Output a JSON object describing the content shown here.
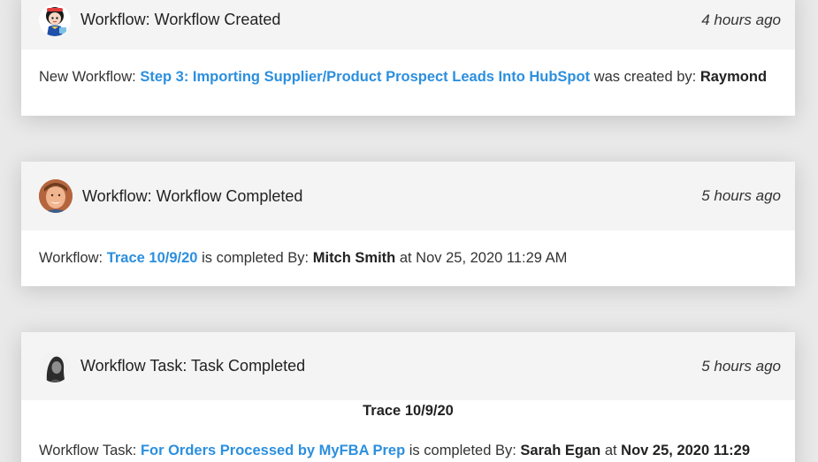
{
  "feed": {
    "items": [
      {
        "avatar_icon": "snow-white-avatar-icon",
        "title": "Workflow: Workflow Created",
        "time": "4 hours ago",
        "body": {
          "prefix": "New Workflow:",
          "link": "Step 3: Importing Supplier/Product Prospect Leads Into HubSpot",
          "middle": "was created by:",
          "user": "Raymond"
        }
      },
      {
        "avatar_icon": "user-photo-avatar-icon",
        "title": "Workflow: Workflow Completed",
        "time": "5 hours ago",
        "body": {
          "prefix": "Workflow:",
          "link": "Trace 10/9/20",
          "middle": "is completed By:",
          "user": "Mitch Smith",
          "suffix": "at Nov 25, 2020 11:29 AM"
        }
      },
      {
        "avatar_icon": "user-photo-avatar-icon",
        "title": "Workflow Task: Task Completed",
        "time": "5 hours ago",
        "body": {
          "heading": "Trace 10/9/20",
          "prefix": "Workflow Task:",
          "link": "For Orders Processed by MyFBA Prep",
          "middle": "is completed By:",
          "user": "Sarah Egan",
          "at": "at",
          "date": "Nov 25, 2020 11:29"
        }
      }
    ]
  },
  "colors": {
    "link": "#2c8fde",
    "header_bg": "#f4f4f4",
    "page_bg": "#e9e9e9"
  }
}
